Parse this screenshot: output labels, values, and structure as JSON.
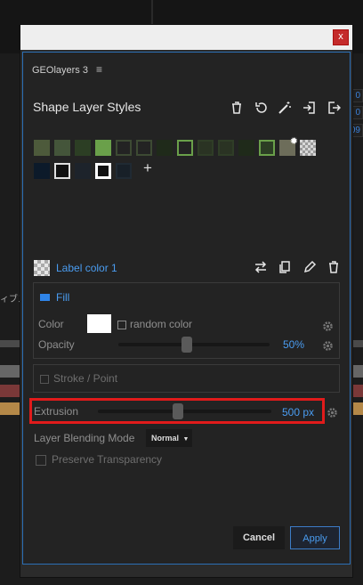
{
  "background": {
    "right_values": [
      "0",
      "0",
      "09"
    ],
    "left_text": "ィブス"
  },
  "dialog": {
    "close_label": "x"
  },
  "panel": {
    "app_name": "GEOlayers 3",
    "title": "Shape Layer Styles"
  },
  "swatches": {
    "add_label": "+",
    "items": [
      {
        "name": "preset-1",
        "style": "filled",
        "color": "#4d5a3b"
      },
      {
        "name": "preset-2",
        "style": "filled",
        "color": "#44553a"
      },
      {
        "name": "preset-3",
        "style": "filled",
        "color": "#2c3e24"
      },
      {
        "name": "preset-4",
        "style": "filled",
        "color": "#6aa04a"
      },
      {
        "name": "preset-5",
        "style": "outlined-dark",
        "color": "#232323"
      },
      {
        "name": "preset-6",
        "style": "outlined-dark",
        "color": "#232323"
      },
      {
        "name": "preset-7",
        "style": "filled-dark",
        "color": "#1f2a1a"
      },
      {
        "name": "preset-8",
        "style": "outlined-green",
        "color": "#232323"
      },
      {
        "name": "preset-9",
        "style": "outlined-dark-green",
        "color": "#2a3323"
      },
      {
        "name": "preset-10",
        "style": "outlined-dark-green",
        "color": "#2a3323"
      },
      {
        "name": "preset-11",
        "style": "filled-dark",
        "color": "#1f2a1a"
      },
      {
        "name": "preset-12",
        "style": "outlined-green-filled",
        "color": "#2c3e24"
      },
      {
        "name": "preset-13",
        "style": "gear-mixed",
        "color": "#6d6d5a"
      },
      {
        "name": "preset-14",
        "style": "checker",
        "color": "#aaaaaa"
      },
      {
        "name": "preset-15",
        "style": "filled",
        "color": "#0c1a2a"
      },
      {
        "name": "preset-16",
        "style": "outlined-white",
        "color": "#111111"
      },
      {
        "name": "preset-17",
        "style": "filled",
        "color": "#1d232b"
      },
      {
        "name": "preset-18",
        "style": "outlined-white-thick",
        "color": "#101010"
      },
      {
        "name": "preset-19",
        "style": "filled",
        "color": "#182028"
      }
    ]
  },
  "label": {
    "title": "Label color 1"
  },
  "fill": {
    "title": "Fill",
    "color_label": "Color",
    "color_value": "#ffffff",
    "random_color_label": "random color",
    "opacity_label": "Opacity",
    "opacity_value": "50%",
    "opacity_fraction": 0.5
  },
  "stroke": {
    "title": "Stroke / Point"
  },
  "extrusion": {
    "label": "Extrusion",
    "value": "500 px",
    "fraction": 0.5
  },
  "blending": {
    "label": "Layer Blending Mode",
    "mode": "Normal"
  },
  "preserve": {
    "label": "Preserve Transparency"
  },
  "buttons": {
    "cancel": "Cancel",
    "apply": "Apply"
  },
  "colors": {
    "accent_blue": "#4a9cf0",
    "highlight_red": "#e11b1b",
    "close_red": "#c42b2b"
  }
}
